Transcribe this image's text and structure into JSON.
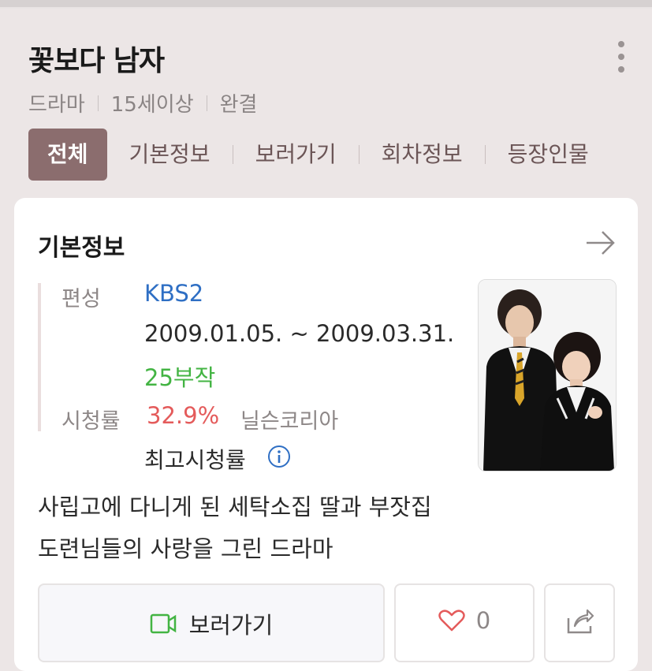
{
  "header": {
    "title": "꽃보다 남자",
    "meta": [
      "드라마",
      "15세이상",
      "완결"
    ]
  },
  "tabs": [
    {
      "label": "전체",
      "active": true
    },
    {
      "label": "기본정보",
      "active": false
    },
    {
      "label": "보러가기",
      "active": false
    },
    {
      "label": "회차정보",
      "active": false
    },
    {
      "label": "등장인물",
      "active": false
    }
  ],
  "card": {
    "title": "기본정보",
    "info": {
      "broadcast_label": "편성",
      "broadcaster": "KBS2",
      "dates": "2009.01.05. ~ 2009.03.31.",
      "episodes": "25부작",
      "rating_label": "시청률",
      "rating": "32.9%",
      "rating_source": "닐슨코리아",
      "rating_note": "최고시청률"
    },
    "description": [
      "사립고에 다니게 된 세탁소집 딸과 부잣집",
      "도련님들의 사랑을 그린 드라마"
    ],
    "actions": {
      "watch_label": "보러가기",
      "like_count": "0"
    }
  },
  "colors": {
    "background": "#ece6e6",
    "active_tab": "#8b6d6e",
    "link_blue": "#2f6fc4",
    "episode_green": "#43b443",
    "rating_red": "#e45b5b"
  },
  "icons": [
    "more-vertical-icon",
    "arrow-right-icon",
    "info-icon",
    "play-video-icon",
    "heart-icon",
    "share-icon"
  ]
}
